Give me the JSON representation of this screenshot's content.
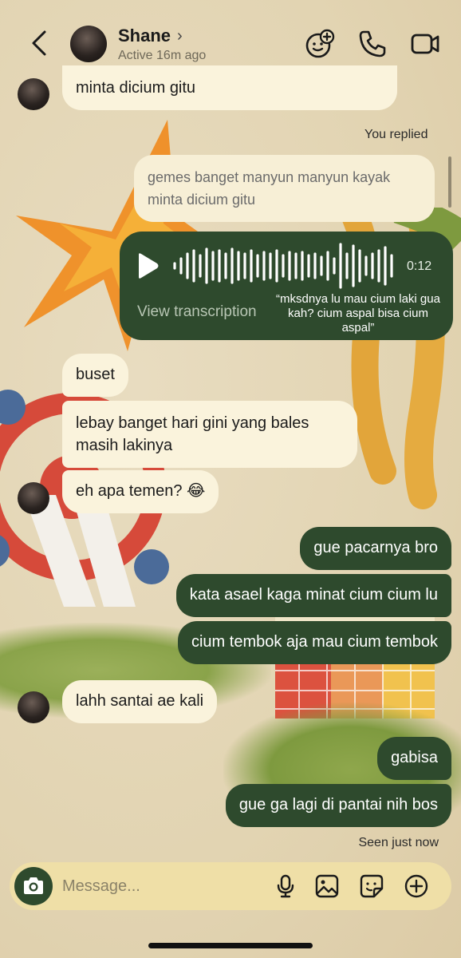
{
  "header": {
    "contact_name": "Shane",
    "status": "Active 16m ago"
  },
  "messages": {
    "m0": "minta dicium gitu",
    "you_replied": "You replied",
    "quoted": "gemes banget manyun manyun kayak\nminta dicium gitu",
    "voice": {
      "duration": "0:12",
      "view_transcription": "View transcription",
      "transcription": "“mksdnya lu mau cium laki gua kah? cium aspal bisa cium aspal”"
    },
    "m1": "buset",
    "m2": "lebay banget hari gini yang bales\nmasih lakinya",
    "m3": "eh apa temen? 😂",
    "m4": "gue pacarnya bro",
    "m5": "kata asael kaga minat cium cium lu",
    "m6": "cium tembok aja mau cium tembok",
    "m7": "lahh santai ae kali",
    "m8": "gabisa",
    "m9": "gue ga lagi di pantai nih bos",
    "seen": "Seen just now"
  },
  "composer": {
    "placeholder": "Message..."
  },
  "icons": {
    "back": "chevron-left-icon",
    "video_effects": "face-plus-icon",
    "call": "phone-icon",
    "video": "video-camera-icon",
    "camera": "camera-icon",
    "mic": "microphone-icon",
    "gallery": "image-icon",
    "sticker": "sticker-icon",
    "add": "plus-circle-icon"
  },
  "colors": {
    "outgoing_bubble": "#2e4a2d",
    "incoming_bubble": "#faf3dc",
    "background": "#efe3c1"
  }
}
